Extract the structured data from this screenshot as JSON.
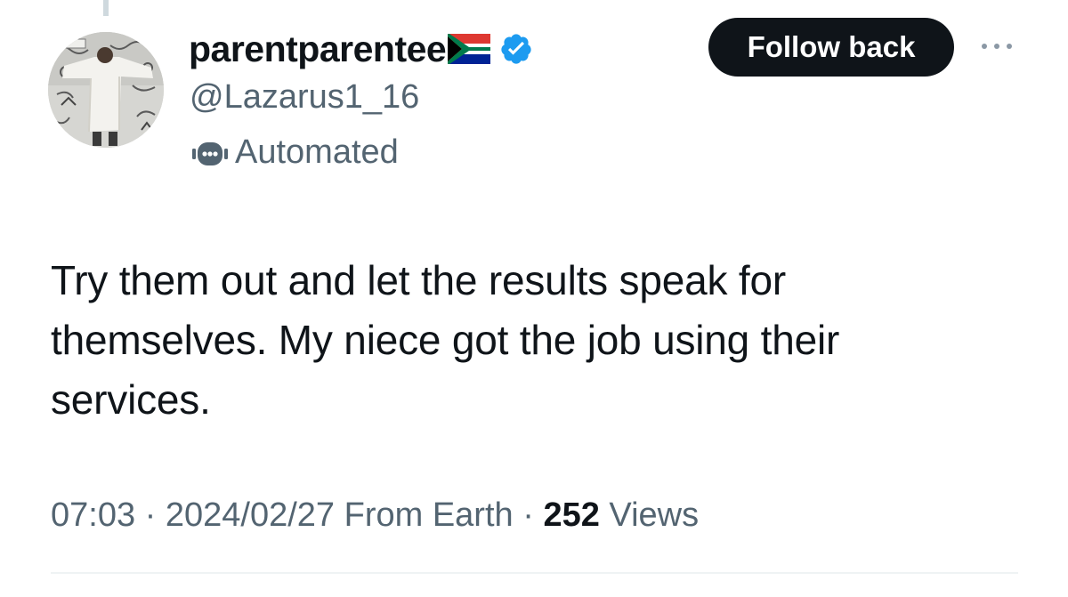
{
  "tweet": {
    "author": {
      "display_name": "parentparentee",
      "flag_icon": "south-africa-flag-icon",
      "verified_icon": "verified-badge-icon",
      "handle": "@Lazarus1_16",
      "label": "Automated",
      "label_icon": "robot-icon"
    },
    "follow_button": "Follow back",
    "more_icon": "more-options-icon",
    "text": "Try them out and let the results speak for\nthemselves. My niece got the job using their\nservices.",
    "meta": {
      "time": "07:03",
      "sep1": " · ",
      "date": "2024/02/27",
      "source": " From Earth",
      "sep2": " · ",
      "views_count": "252",
      "views_label": " Views"
    }
  },
  "colors": {
    "text_primary": "#0f1419",
    "text_secondary": "#536471",
    "verified_blue": "#1d9bf0",
    "button_bg": "#0f1419"
  }
}
